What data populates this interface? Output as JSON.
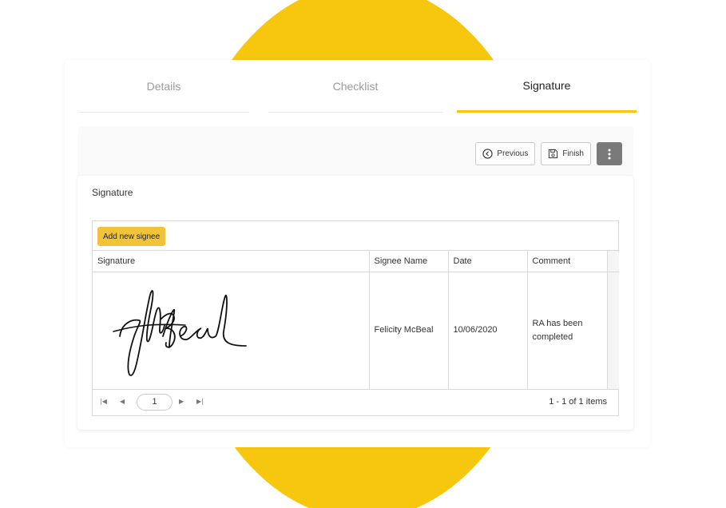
{
  "tabs": [
    {
      "label": "Details",
      "active": false
    },
    {
      "label": "Checklist",
      "active": false
    },
    {
      "label": "Signature",
      "active": true
    }
  ],
  "toolbar": {
    "previous_label": "Previous",
    "finish_label": "Finish",
    "more_icon": "more-vertical-icon"
  },
  "section": {
    "title": "Signature"
  },
  "grid": {
    "add_label": "Add new signee",
    "columns": [
      "Signature",
      "Signee Name",
      "Date",
      "Comment"
    ],
    "rows": [
      {
        "signature_text": "J McBeal",
        "signee_name": "Felicity McBeal",
        "date": "10/06/2020",
        "comment": "RA has been completed"
      }
    ]
  },
  "pager": {
    "first_icon": "first-page-icon",
    "prev_icon": "prev-page-icon",
    "next_icon": "next-page-icon",
    "last_icon": "last-page-icon",
    "page": "1",
    "info": "1 - 1 of 1 items"
  },
  "colors": {
    "accent": "#f7c70f",
    "add_button": "#f1c33b",
    "more_button": "#7a7a7a"
  }
}
